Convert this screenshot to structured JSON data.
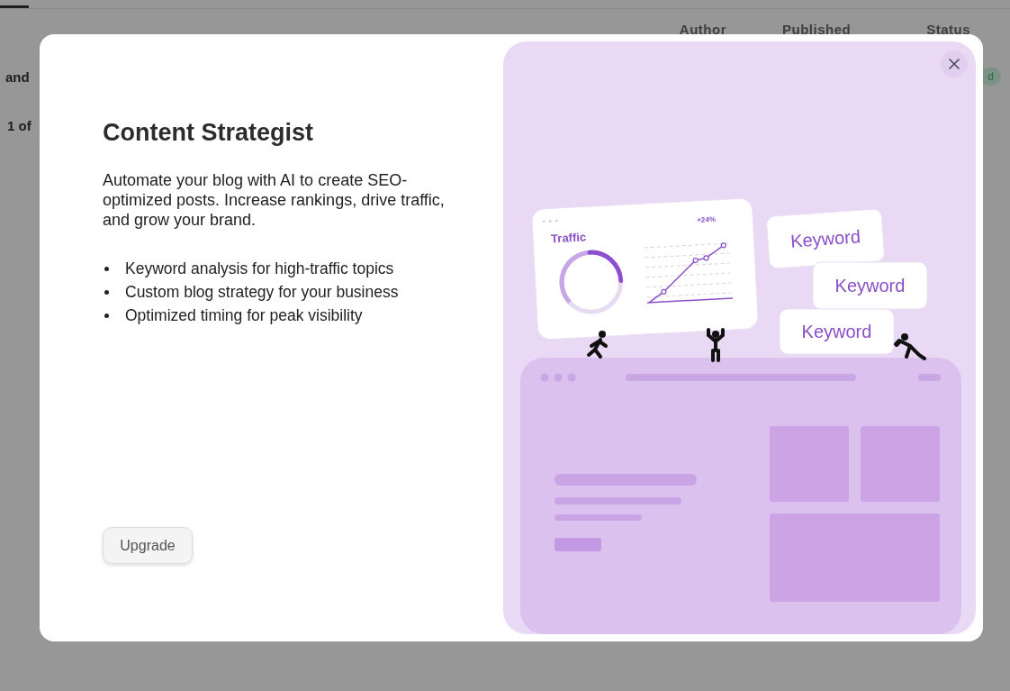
{
  "background_page": {
    "columns": [
      "Author",
      "Published",
      "Status"
    ],
    "row_text": "and",
    "pagination": "1 of",
    "badge": "d"
  },
  "modal": {
    "title": "Content Strategist",
    "description": "Automate your blog with AI to create SEO-optimized posts. Increase rankings, drive traffic, and grow your brand.",
    "features": [
      "Keyword analysis for high-traffic topics",
      "Custom blog strategy for your business",
      "Optimized timing for peak visibility"
    ],
    "button": "Upgrade",
    "illustration": {
      "traffic_card": {
        "title": "Traffic",
        "change": "+24%"
      },
      "keywords": [
        "Keyword",
        "Keyword",
        "Keyword"
      ]
    }
  }
}
